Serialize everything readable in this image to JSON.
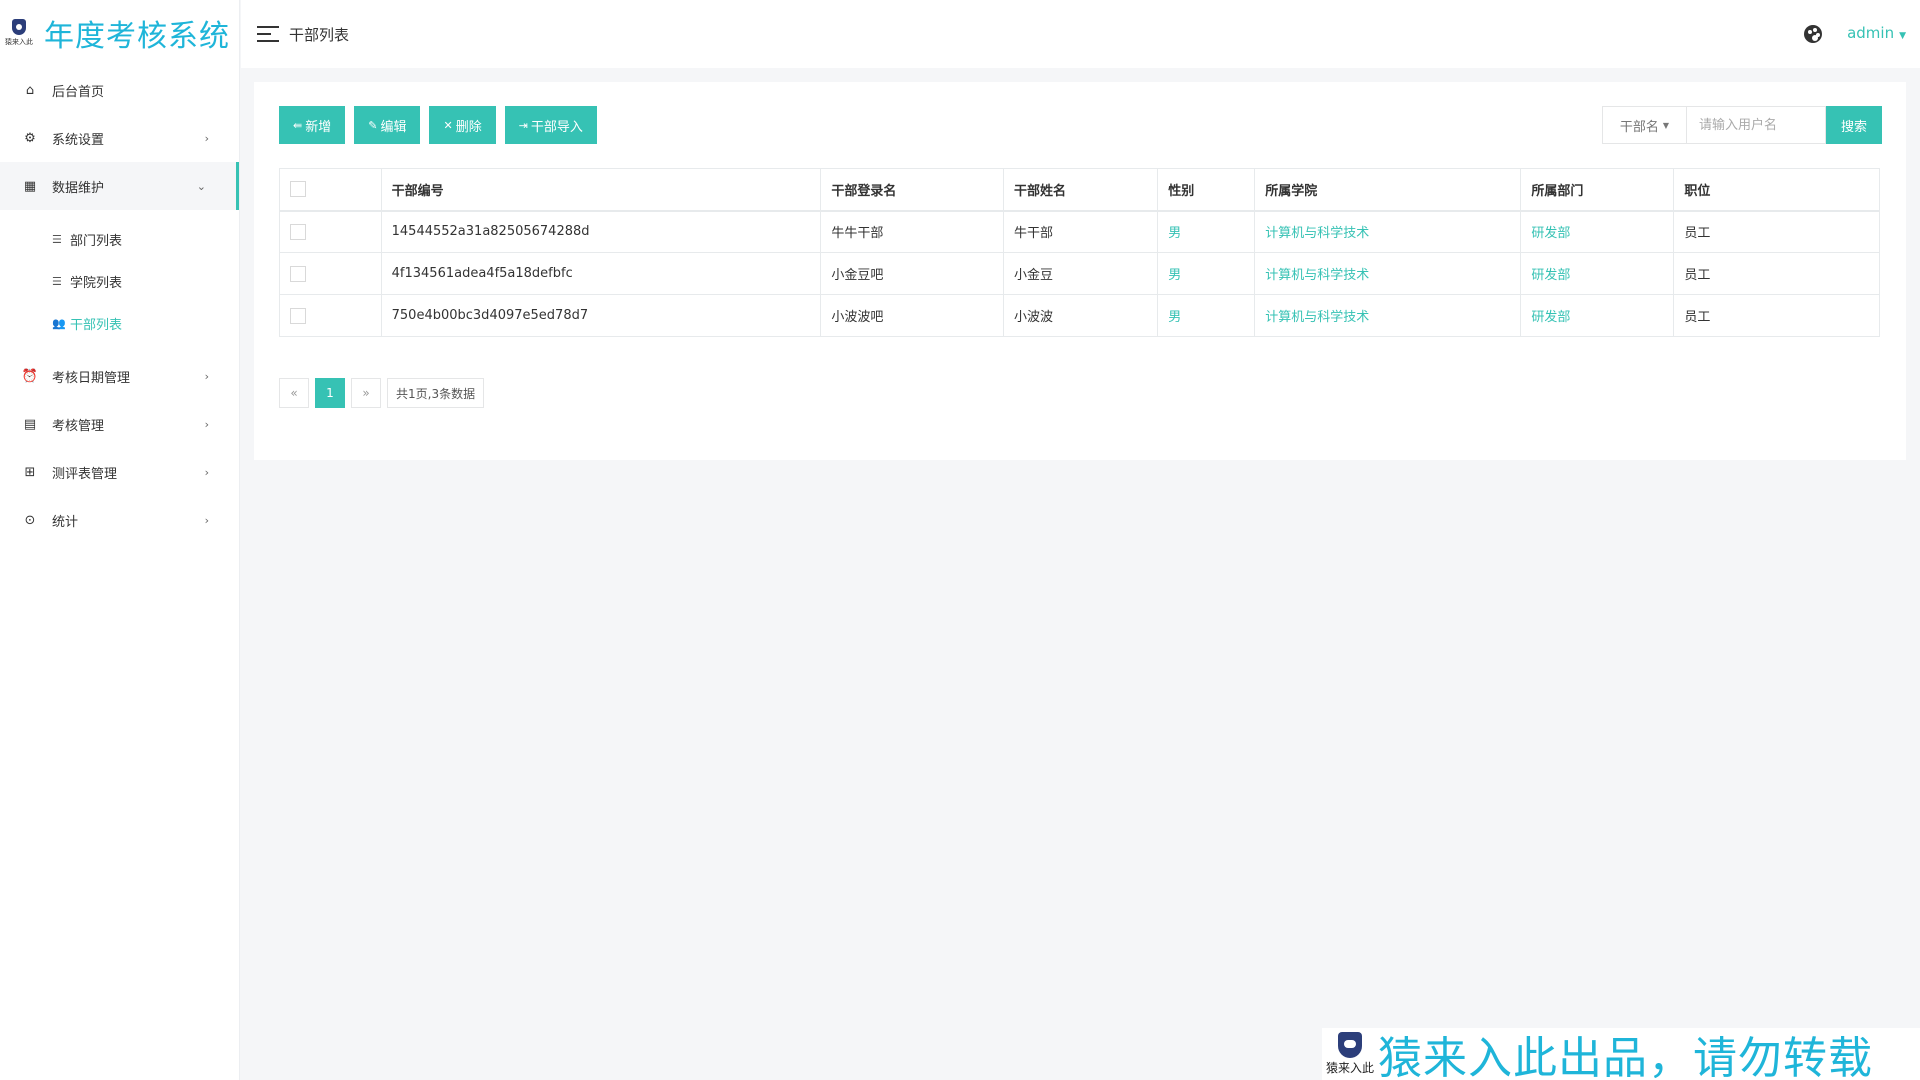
{
  "brand": {
    "logo_text": "猿来入此",
    "title": "年度考核系统"
  },
  "header": {
    "page_title": "干部列表",
    "user": "admin"
  },
  "sidebar": {
    "items": [
      {
        "label": "后台首页",
        "icon": "home-icon",
        "has_children": false
      },
      {
        "label": "系统设置",
        "icon": "gear-icon",
        "has_children": true
      },
      {
        "label": "数据维护",
        "icon": "calendar-icon",
        "has_children": true,
        "expanded": true,
        "children": [
          {
            "label": "部门列表",
            "icon": "list-icon"
          },
          {
            "label": "学院列表",
            "icon": "list-icon"
          },
          {
            "label": "干部列表",
            "icon": "users-icon",
            "active": true
          }
        ]
      },
      {
        "label": "考核日期管理",
        "icon": "alarm-clock-icon",
        "has_children": true
      },
      {
        "label": "考核管理",
        "icon": "document-icon",
        "has_children": true
      },
      {
        "label": "测评表管理",
        "icon": "grid-icon",
        "has_children": true
      },
      {
        "label": "统计",
        "icon": "target-icon",
        "has_children": true
      }
    ]
  },
  "toolbar": {
    "add": "新增",
    "edit": "编辑",
    "delete": "删除",
    "import": "干部导入"
  },
  "search": {
    "type": "干部名",
    "placeholder": "请输入用户名",
    "button": "搜索"
  },
  "table": {
    "columns": [
      "干部编号",
      "干部登录名",
      "干部姓名",
      "性别",
      "所属学院",
      "所属部门",
      "职位"
    ],
    "rows": [
      [
        "14544552a31a82505674288d",
        "牛牛干部",
        "牛干部",
        "男",
        "计算机与科学技术",
        "研发部",
        "员工"
      ],
      [
        "4f134561adea4f5a18defbfc",
        "小金豆吧",
        "小金豆",
        "男",
        "计算机与科学技术",
        "研发部",
        "员工"
      ],
      [
        "750e4b00bc3d4097e5ed78d7",
        "小波波吧",
        "小波波",
        "男",
        "计算机与科学技术",
        "研发部",
        "员工"
      ]
    ]
  },
  "pagination": {
    "prev": "«",
    "current": "1",
    "next": "»",
    "info": "共1页,3条数据"
  },
  "watermark": {
    "logo_text": "猿来入此",
    "text": "猿来入此出品，请勿转载"
  },
  "colors": {
    "accent": "#36c2b4",
    "brand": "#1fb5d9"
  }
}
